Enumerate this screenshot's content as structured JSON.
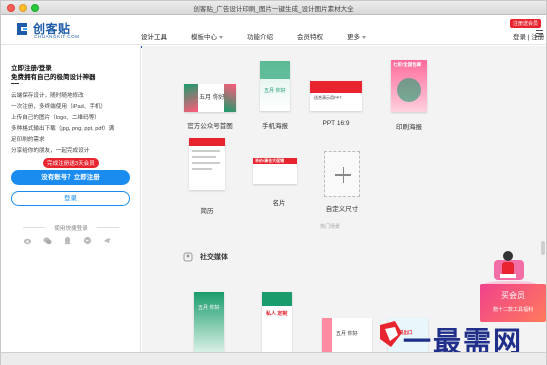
{
  "window": {
    "title": "创客贴_广告设计印刷_图片一键生成_设计图片素材大全"
  },
  "brand": {
    "name": "创客贴",
    "domain": "CHUANGKIT.COM"
  },
  "nav": {
    "items": [
      {
        "label": "设计工具",
        "active": true,
        "has_arrow": false
      },
      {
        "label": "模板中心",
        "active": false,
        "has_arrow": true
      },
      {
        "label": "功能介绍",
        "active": false,
        "has_arrow": false
      },
      {
        "label": "会员特权",
        "active": false,
        "has_arrow": false
      },
      {
        "label": "更多",
        "active": false,
        "has_arrow": true
      }
    ],
    "promo_badge": "注册送会员",
    "login": "登录 | 注册"
  },
  "left_panel": {
    "heading1": "立即注册/登录",
    "heading2": "免费拥有自己的极简设计神器",
    "features": [
      "云端保存设计，随时随地修改",
      "一次注册，多终端使用（iPad、手机）",
      "上传自己的图片（logo、二维码等）",
      "多种格式输出下载（jpg, png, ppt, pdf）满",
      "足印刷的需求",
      "分享给你的朋友，一起完成设计"
    ],
    "register_badge": "完成注册送3天会员",
    "register_button": "没有账号？立即注册",
    "login_button": "登录",
    "quick_login_label": "使用快捷登录",
    "social_icons": [
      "weibo-icon",
      "wechat-icon",
      "qq-icon",
      "dingtalk-icon",
      "bird-icon"
    ]
  },
  "templates": {
    "row1": [
      {
        "label": "官方公众号首图",
        "thumb_text": "五月 你好"
      },
      {
        "label": "手机海报",
        "thumb_text": "五月 你好"
      },
      {
        "label": "PPT 16:9",
        "thumb_text": "适合演示用PPT"
      },
      {
        "label": "印刷海报",
        "thumb_text": "七折/全国包邮"
      }
    ],
    "row2": [
      {
        "label": "简历",
        "thumb_text": ""
      },
      {
        "label": "名片",
        "thumb_text": "半价/清仓大促销"
      },
      {
        "label": "自定义尺寸",
        "thumb_text": ""
      }
    ],
    "divider_label": "热门场景",
    "section_title": "社交媒体",
    "row3": [
      {
        "thumb_text": "五月 你好"
      },
      {
        "thumb_text": "私人 定制"
      },
      {
        "thumb_text": "五月 你好"
      },
      {
        "thumb_text": "爱要说出口"
      }
    ]
  },
  "promo": {
    "main": "买会员",
    "sub": "赠十二款工具福利"
  },
  "watermark": "一最需网",
  "colors": {
    "accent": "#1a8cf0",
    "brand": "#1e5ba8",
    "badge": "#e8242e",
    "promo": "#f0428c"
  }
}
